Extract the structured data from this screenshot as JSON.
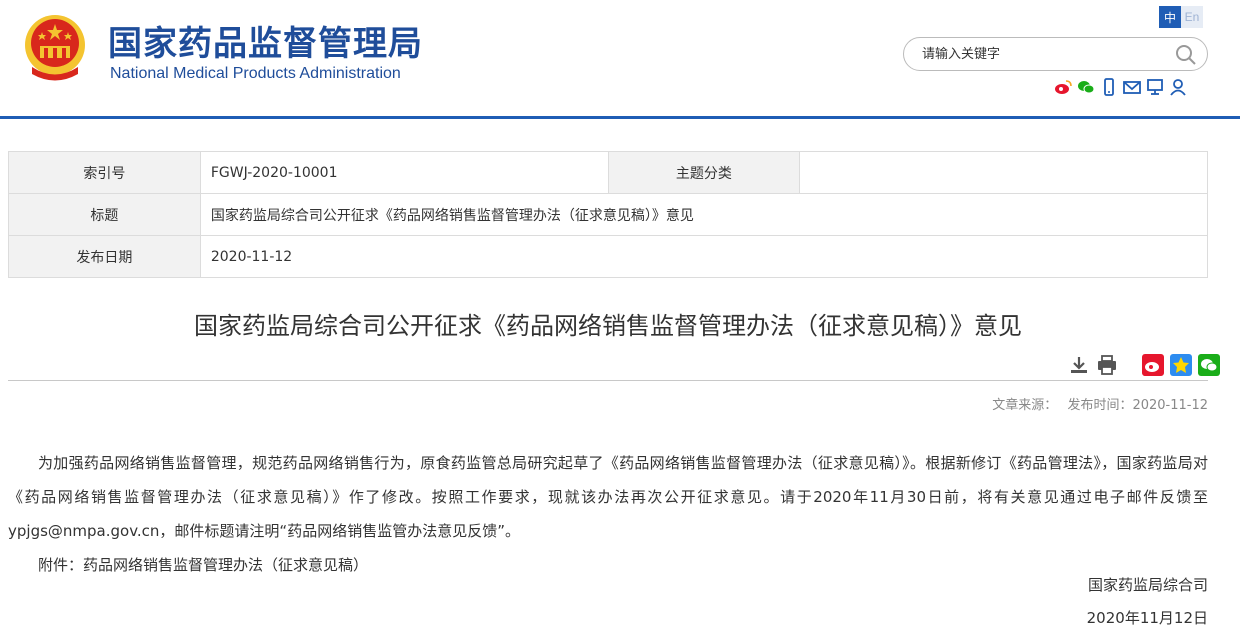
{
  "header": {
    "title_cn": "国家药品监督管理局",
    "title_en": "National Medical Products Administration",
    "lang_zh": "中",
    "lang_en": "En",
    "search_placeholder": "请输入关键字"
  },
  "info": {
    "index_label": "索引号",
    "index_value": "FGWJ-2020-10001",
    "topic_label": "主题分类",
    "topic_value": "",
    "title_label": "标题",
    "title_value": "国家药监局综合司公开征求《药品网络销售监督管理办法（征求意见稿）》意见",
    "date_label": "发布日期",
    "date_value": "2020-11-12"
  },
  "article": {
    "title": "国家药监局综合司公开征求《药品网络销售监督管理办法（征求意见稿）》意见",
    "source_label": "文章来源：",
    "publish_label": "发布时间：2020-11-12",
    "paragraph1": "为加强药品网络销售监督管理，规范药品网络销售行为，原食药监管总局研究起草了《药品网络销售监督管理办法（征求意见稿）》。根据新修订《药品管理法》，国家药监局对《药品网络销售监督管理办法（征求意见稿）》作了修改。按照工作要求，现就该办法再次公开征求意见。请于2020年11月30日前，将有关意见通过电子邮件反馈至ypjgs@nmpa.gov.cn，邮件标题请注明“药品网络销售监管办法意见反馈”。",
    "paragraph2": "附件：药品网络销售监督管理办法（征求意见稿）",
    "signature": "国家药监局综合司",
    "sign_date": "2020年11月12日"
  },
  "colors": {
    "brand_blue": "#1f4d9a",
    "rule_blue": "#1f5db5",
    "emblem_red": "#d8271c",
    "emblem_gold": "#f4c430"
  }
}
